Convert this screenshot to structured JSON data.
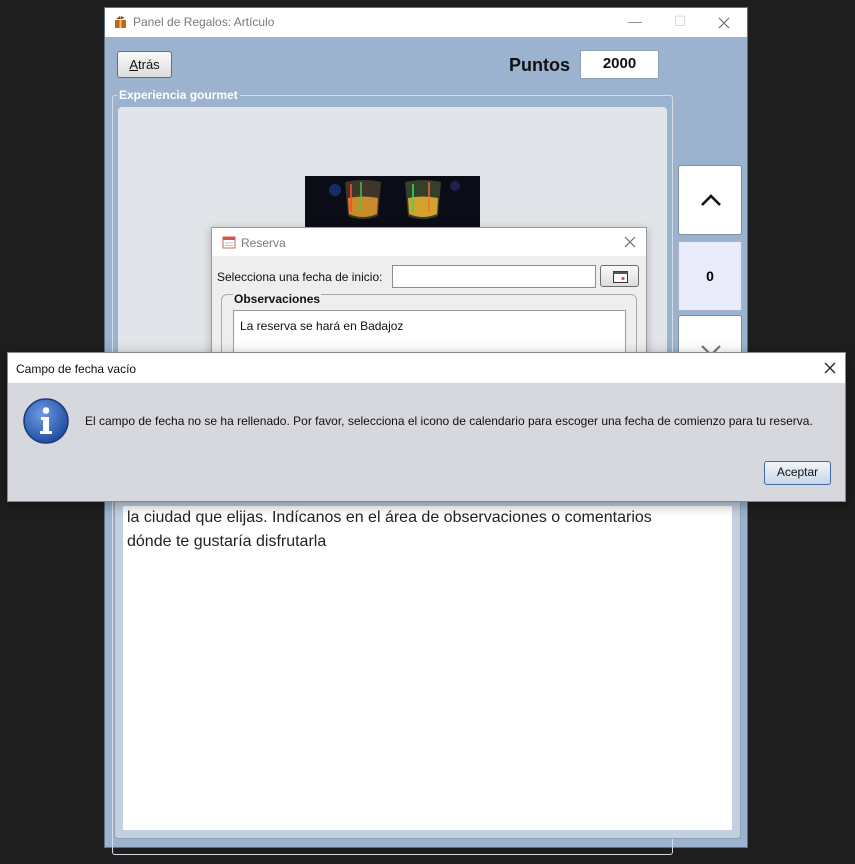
{
  "main_window": {
    "title": "Panel de Regalos: Artículo",
    "back_label": "Atrás",
    "back_mnemonic": "A",
    "back_rest": "trás",
    "points_label": "Puntos",
    "points_value": "2000",
    "group_title": "Experiencia gourmet",
    "counter": "0",
    "description_lines": [
      "la ciudad que elijas. Indícanos en el área de observaciones o comentarios",
      "dónde te gustaría disfrutarla"
    ]
  },
  "reserva_dialog": {
    "title": "Reserva",
    "date_label": "Selecciona una fecha de inicio:",
    "date_value": "",
    "observations_title": "Observaciones",
    "observations_text": "La reserva se hará en Badajoz"
  },
  "alert_dialog": {
    "title": "Campo de fecha vacío",
    "message": "El campo de fecha no se ha rellenado. Por favor, selecciona el icono de calendario para escoger una fecha de comienzo para tu reserva.",
    "accept_label": "Aceptar"
  },
  "icons": {
    "app": "gift-icon",
    "info": "info-icon",
    "calendar": "calendar-icon",
    "up": "chevron-up-icon",
    "down": "chevron-down-icon",
    "close": "close-icon"
  },
  "colors": {
    "window_bg": "#9bb3cf",
    "info_blue": "#2f5fb8",
    "accent_border": "#3f6aa6"
  }
}
